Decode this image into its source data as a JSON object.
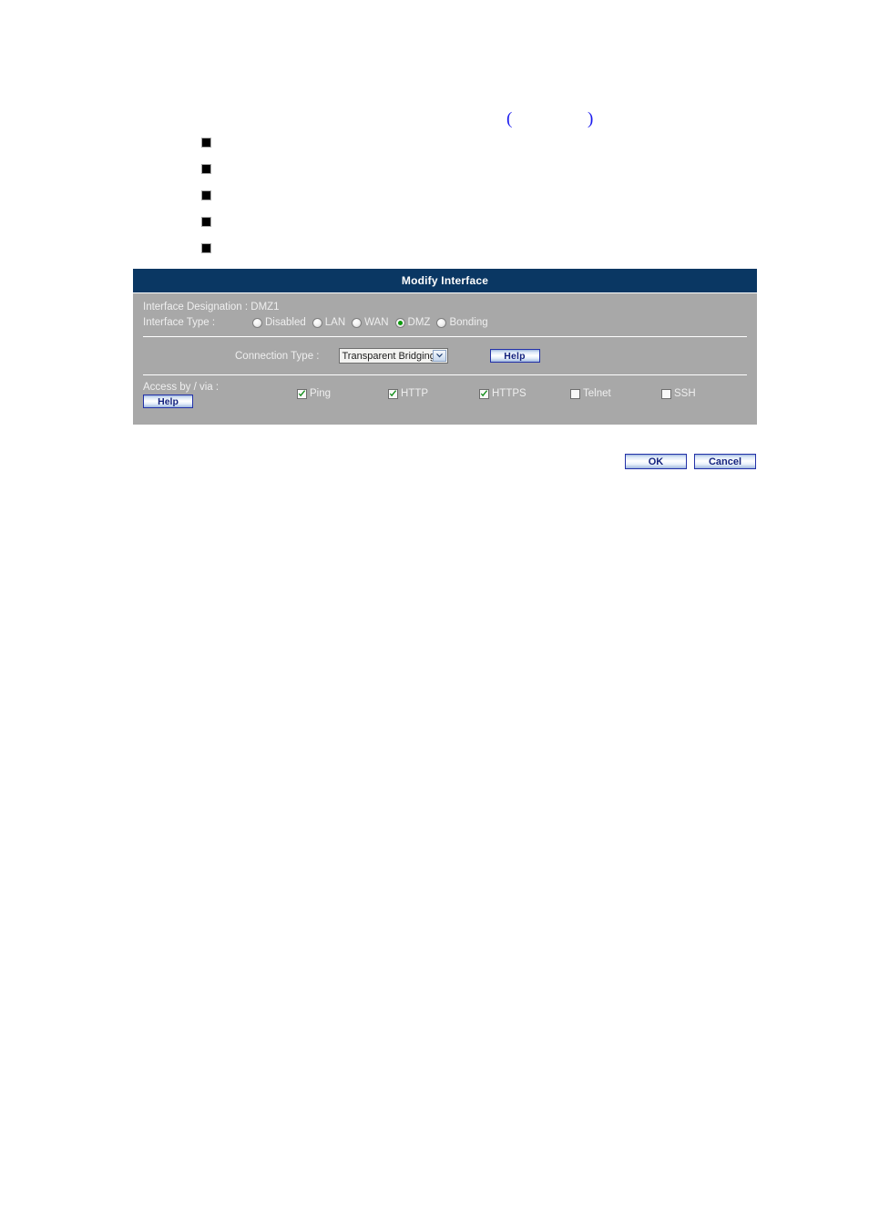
{
  "page": {
    "paren_open": "(",
    "paren_close": ")",
    "bullets": [
      "",
      "",
      "",
      "",
      ""
    ]
  },
  "dialog": {
    "title": "Modify Interface",
    "interface_designation": {
      "label": "Interface Designation :",
      "value": "DMZ1",
      "full": "Interface Designation : DMZ1"
    },
    "interface_type": {
      "label": "Interface Type :",
      "options": [
        {
          "label": "Disabled",
          "selected": false
        },
        {
          "label": "LAN",
          "selected": false
        },
        {
          "label": "WAN",
          "selected": false
        },
        {
          "label": "DMZ",
          "selected": true
        },
        {
          "label": "Bonding",
          "selected": false
        }
      ],
      "selected_value": "DMZ"
    },
    "connection_type": {
      "label": "Connection Type :",
      "selected": "Transparent Bridging",
      "help_label": "Help"
    },
    "access": {
      "label": "Access by / via :",
      "help_label": "Help",
      "options": [
        {
          "label": "Ping",
          "checked": true
        },
        {
          "label": "HTTP",
          "checked": true
        },
        {
          "label": "HTTPS",
          "checked": true
        },
        {
          "label": "Telnet",
          "checked": false
        },
        {
          "label": "SSH",
          "checked": false
        }
      ]
    }
  },
  "footer": {
    "ok_label": "OK",
    "cancel_label": "Cancel"
  },
  "colors": {
    "title_bar": "#0a3763",
    "panel": "#a8a8a8",
    "label_text": "#efefef",
    "radio_selected": "#0a9a0a",
    "check_mark": "#0a8a12",
    "button_text": "#14227e",
    "paren": "#1a1aee"
  }
}
